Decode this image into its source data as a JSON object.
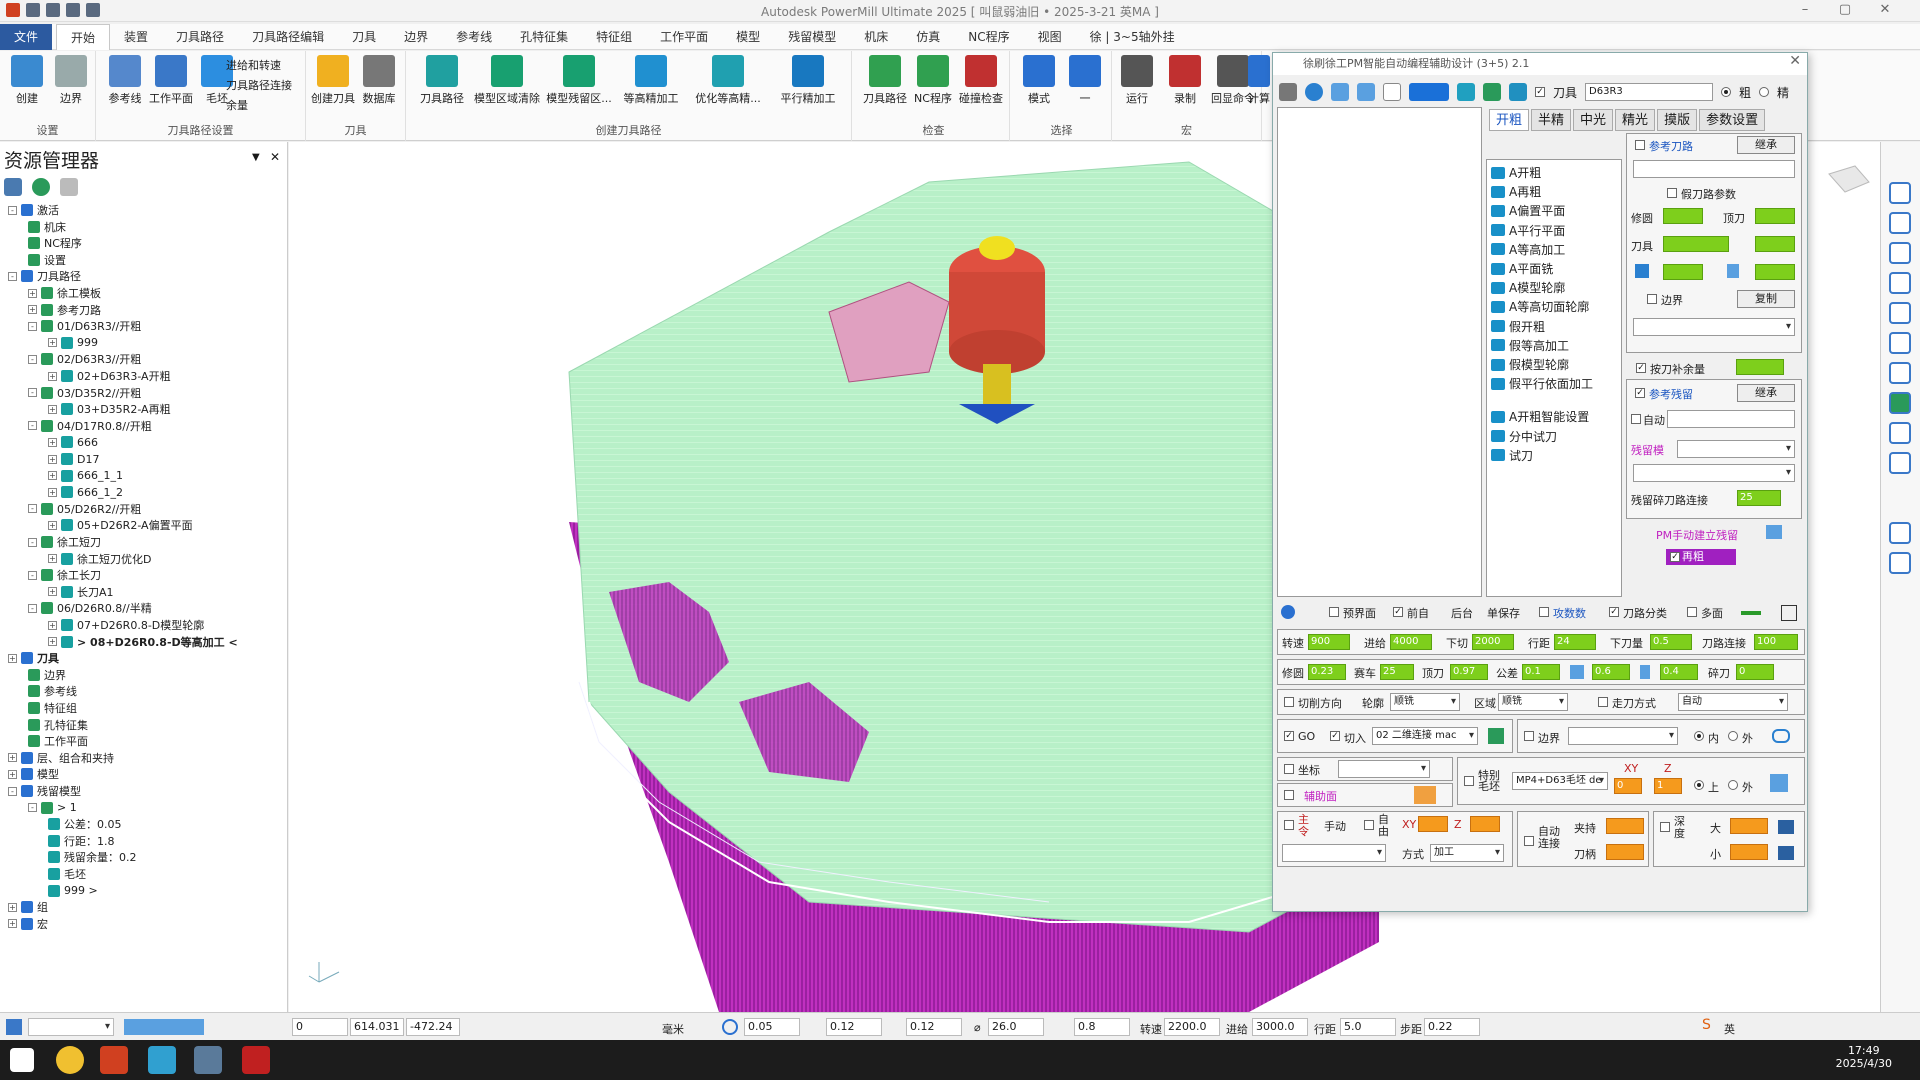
{
  "window": {
    "title": "Autodesk PowerMill Ultimate 2025   [ 叫鼠弱油旧 • 2025-3-21 英MA ]"
  },
  "menu": [
    "文件",
    "开始",
    "装置",
    "刀具路径",
    "刀具路径编辑",
    "刀具",
    "边界",
    "参考线",
    "孔特征集",
    "特征组",
    "工作平面",
    "模型",
    "残留模型",
    "机床",
    "仿真",
    "NC程序",
    "视图",
    "徐 | 3~5轴外挂"
  ],
  "ribbon": {
    "groups": [
      {
        "label": "设置",
        "buttons": [
          "创建",
          "边界"
        ]
      },
      {
        "label": "刀具路径设置",
        "buttons": [
          "参考线",
          "工作平面",
          "毛坯"
        ],
        "small": [
          "进给和转速",
          "刀具路径连接",
          "余量"
        ]
      },
      {
        "label": "刀具",
        "buttons": [
          "创建刀具",
          "数据库"
        ]
      },
      {
        "label": "创建刀具路径",
        "buttons": [
          "刀具路径",
          "模型区域清除",
          "模型残留区...",
          "等高精加工",
          "优化等高精...",
          "平行精加工"
        ]
      },
      {
        "label": "检查",
        "buttons": [
          "刀具路径",
          "NC程序",
          "碰撞检查"
        ]
      },
      {
        "label": "选择",
        "buttons": [
          "模式",
          "一"
        ]
      },
      {
        "label": "宏",
        "buttons": [
          "运行",
          "录制",
          "回显命令"
        ]
      },
      {
        "label": "",
        "buttons": [
          "计算"
        ]
      }
    ]
  },
  "explorer": {
    "title": "资源管理器",
    "tree": [
      {
        "t": "激活",
        "lv": 0,
        "pm": "-"
      },
      {
        "t": "机床",
        "lv": 1
      },
      {
        "t": "NC程序",
        "lv": 1
      },
      {
        "t": "设置",
        "lv": 1
      },
      {
        "t": "刀具路径",
        "lv": 0,
        "pm": "-"
      },
      {
        "t": "徐工模板",
        "lv": 1,
        "pm": "+"
      },
      {
        "t": "参考刀路",
        "lv": 1,
        "pm": "+"
      },
      {
        "t": "01/D63R3//开粗",
        "lv": 1,
        "pm": "-"
      },
      {
        "t": "999",
        "lv": 2,
        "pm": "+"
      },
      {
        "t": "02/D63R3//开粗",
        "lv": 1,
        "pm": "-"
      },
      {
        "t": "02+D63R3-A开粗",
        "lv": 2,
        "pm": "+"
      },
      {
        "t": "03/D35R2//开粗",
        "lv": 1,
        "pm": "-"
      },
      {
        "t": "03+D35R2-A再粗",
        "lv": 2,
        "pm": "+"
      },
      {
        "t": "04/D17R0.8//开粗",
        "lv": 1,
        "pm": "-"
      },
      {
        "t": "666",
        "lv": 2,
        "pm": "+"
      },
      {
        "t": "D17",
        "lv": 2,
        "pm": "+"
      },
      {
        "t": "666_1_1",
        "lv": 2,
        "pm": "+"
      },
      {
        "t": "666_1_2",
        "lv": 2,
        "pm": "+"
      },
      {
        "t": "05/D26R2//开粗",
        "lv": 1,
        "pm": "-"
      },
      {
        "t": "05+D26R2-A偏置平面",
        "lv": 2,
        "pm": "+"
      },
      {
        "t": "徐工短刀",
        "lv": 1,
        "pm": "-"
      },
      {
        "t": "徐工短刀优化D",
        "lv": 2,
        "pm": "+"
      },
      {
        "t": "徐工长刀",
        "lv": 1,
        "pm": "-"
      },
      {
        "t": "长刀A1",
        "lv": 2,
        "pm": "+"
      },
      {
        "t": "06/D26R0.8//半精",
        "lv": 1,
        "pm": "-"
      },
      {
        "t": "07+D26R0.8-D模型轮廓",
        "lv": 2,
        "pm": "+"
      },
      {
        "t": "> 08+D26R0.8-D等高加工 <",
        "lv": 2,
        "pm": "+",
        "bold": true
      },
      {
        "t": "刀具",
        "lv": 0,
        "pm": "+",
        "bold": true
      },
      {
        "t": "边界",
        "lv": 1
      },
      {
        "t": "参考线",
        "lv": 1
      },
      {
        "t": "特征组",
        "lv": 1
      },
      {
        "t": "孔特征集",
        "lv": 1
      },
      {
        "t": "工作平面",
        "lv": 1
      },
      {
        "t": "层、组合和夹持",
        "lv": 0,
        "pm": "+"
      },
      {
        "t": "模型",
        "lv": 0,
        "pm": "+"
      },
      {
        "t": "残留模型",
        "lv": 0,
        "pm": "-"
      },
      {
        "t": "> 1",
        "lv": 1,
        "pm": "-"
      },
      {
        "t": "公差：0.05",
        "lv": 2
      },
      {
        "t": "行距：1.8",
        "lv": 2
      },
      {
        "t": "残留余量：0.2",
        "lv": 2
      },
      {
        "t": "毛坯",
        "lv": 2
      },
      {
        "t": "999 >",
        "lv": 2
      },
      {
        "t": "组",
        "lv": 0,
        "pm": "+"
      },
      {
        "t": "宏",
        "lv": 0,
        "pm": "+"
      }
    ]
  },
  "dialog": {
    "title": "徐刷徐工PM智能自动编程辅助设计 (3+5) 2.1",
    "tool_label": "刀具",
    "tool_value": "D63R3",
    "radio_rough": "粗",
    "radio_fine": "精",
    "tabs": [
      "开粗",
      "半精",
      "中光",
      "精光",
      "摸版",
      "参数设置"
    ],
    "ops": [
      "A开粗",
      "A再粗",
      "A偏置平面",
      "A平行平面",
      "A等高加工",
      "A平面铣",
      "A模型轮廓",
      "A等高切面轮廓",
      "假开粗",
      "假等高加工",
      "假模型轮廓",
      "假平行依面加工",
      "A开粗智能设置",
      "分中试刀",
      "试刀"
    ],
    "side": {
      "ref_path": "参考刀路",
      "inherit": "继承",
      "fake_param": "假刀路参数",
      "finish": "修圆",
      "tip": "顶刀",
      "tool": "刀具",
      "border": "边界",
      "copy": "复制",
      "stock": "按刀补余量",
      "ref_remain": "参考残留",
      "inherit2": "继承",
      "auto": "自动",
      "rem_model": "残留模",
      "skip_link": "残留碎刀路连接",
      "skip_val": "25",
      "manual": "PM手动建立残留",
      "regen": "再粗"
    },
    "opts": [
      "预界面",
      "前自",
      "后台",
      "单保存",
      "攻数数",
      "刀路分类",
      "多面"
    ],
    "row1": [
      {
        "l": "转速",
        "v": "900"
      },
      {
        "l": "进给",
        "v": "4000"
      },
      {
        "l": "下切",
        "v": "2000"
      },
      {
        "l": "行距",
        "v": "24"
      },
      {
        "l": "下刀量",
        "v": "0.5"
      },
      {
        "l": "刀路连接",
        "v": "100"
      }
    ],
    "row2": [
      {
        "l": "修圆",
        "v": "0.23"
      },
      {
        "l": "赛车",
        "v": "25"
      },
      {
        "l": "顶刀",
        "v": "0.97"
      },
      {
        "l": "公差",
        "v": "0.1"
      },
      {
        "l": "",
        "v": "0.6"
      },
      {
        "l": "",
        "v": "0.4"
      },
      {
        "l": "碎刀",
        "v": "0"
      }
    ],
    "row3": {
      "cut_dir": "切削方向",
      "profile": "轮廓",
      "profile_v": "顺铣",
      "area": "区域",
      "area_v": "顺铣",
      "walk": "走刀方式",
      "walk_v": "自动"
    },
    "row4": {
      "go": "GO",
      "cut": "切入",
      "link": "02 二维连接 mac",
      "edge": "边界",
      "in": "内",
      "out": "外"
    },
    "row5": {
      "coord": "坐标",
      "special": "特别毛坯",
      "special_v": "MP4+D63毛坯 de",
      "xy": "XY",
      "z": "Z",
      "xy_v": "0",
      "z_v": "1",
      "up": "上",
      "down": "外"
    },
    "row6": {
      "aux": "辅助面"
    },
    "row7": {
      "in_feed": "主令",
      "manual": "手动",
      "free": "自由",
      "xy": "XY",
      "z": "Z",
      "method": "方式",
      "method_v": "加工",
      "auto_link": "自动连接",
      "clamp": "夹持",
      "handle": "刀柄",
      "depth": "深度",
      "big": "大",
      "small": "小"
    }
  },
  "status": {
    "v1": "0",
    "v2": "614.031",
    "v3": "-472.24",
    "unit": "毫米",
    "tol": "0.05",
    "stock": "0.12",
    "stock2": "0.12",
    "ang": "26.0",
    "step": "0.8",
    "rpm_l": "转速",
    "rpm": "2200.0",
    "feed_l": "进给",
    "feed": "3000.0",
    "row_l": "行距",
    "row": "5.0",
    "sd_l": "步距",
    "sd": "0.22"
  },
  "taskbar": {
    "time": "17:49",
    "date": "2025/4/30",
    "ime": "英"
  }
}
